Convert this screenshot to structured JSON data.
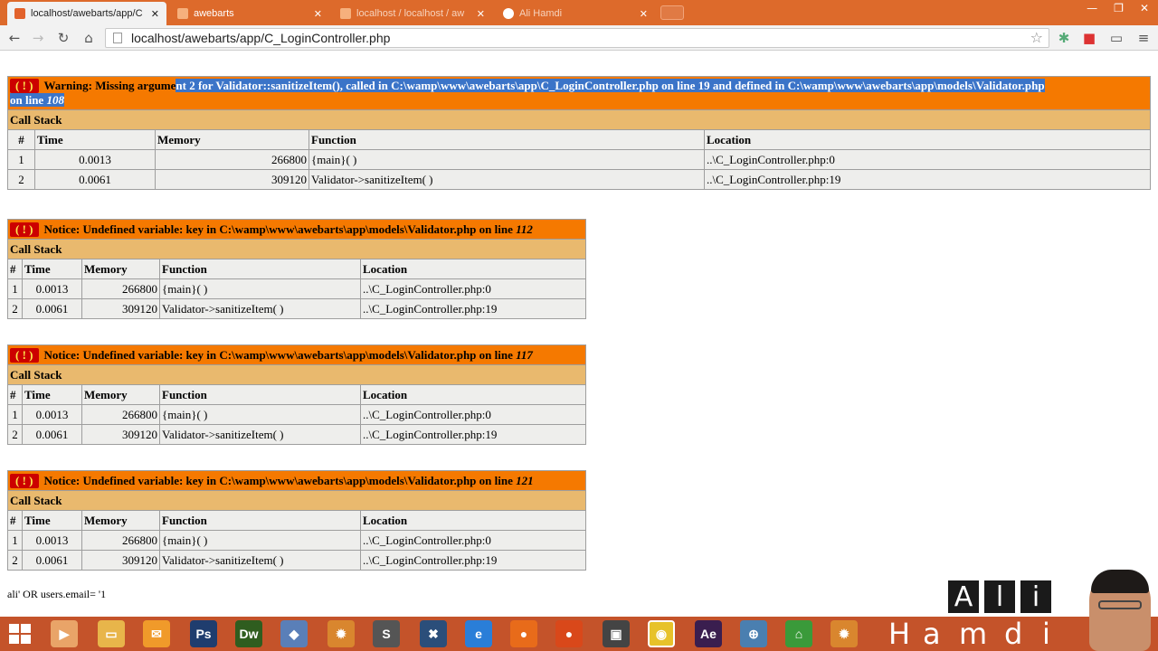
{
  "browser": {
    "tabs": [
      {
        "label": "localhost/awebarts/app/C",
        "active": true
      },
      {
        "label": "awebarts",
        "active": false
      },
      {
        "label": "localhost / localhost / aw",
        "active": false
      },
      {
        "label": "Ali Hamdi",
        "active": false
      }
    ],
    "url": "localhost/awebarts/app/C_LoginController.php"
  },
  "errors": [
    {
      "prefix": "( ! )",
      "message_pre": "Warning: Missing argume",
      "message_sel": "nt 2 for Validator::sanitizeItem(), called in C:\\wamp\\www\\awebarts\\app\\C_LoginController.php on line 19 and defined in C:\\wamp\\www\\awebarts\\app\\models\\Validator.php",
      "message_sel2": "on line ",
      "line": "108",
      "call_stack_label": "Call Stack",
      "columns": [
        "#",
        "Time",
        "Memory",
        "Function",
        "Location"
      ],
      "rows": [
        [
          "1",
          "0.0013",
          "266800",
          "{main}( )",
          "..\\C_LoginController.php:0"
        ],
        [
          "2",
          "0.0061",
          "309120",
          "Validator->sanitizeItem( )",
          "..\\C_LoginController.php:19"
        ]
      ]
    },
    {
      "prefix": "( ! )",
      "message": "Notice: Undefined variable: key in C:\\wamp\\www\\awebarts\\app\\models\\Validator.php on line ",
      "line": "112",
      "call_stack_label": "Call Stack",
      "columns": [
        "#",
        "Time",
        "Memory",
        "Function",
        "Location"
      ],
      "rows": [
        [
          "1",
          "0.0013",
          "266800",
          "{main}( )",
          "..\\C_LoginController.php:0"
        ],
        [
          "2",
          "0.0061",
          "309120",
          "Validator->sanitizeItem( )",
          "..\\C_LoginController.php:19"
        ]
      ]
    },
    {
      "prefix": "( ! )",
      "message": "Notice: Undefined variable: key in C:\\wamp\\www\\awebarts\\app\\models\\Validator.php on line ",
      "line": "117",
      "call_stack_label": "Call Stack",
      "columns": [
        "#",
        "Time",
        "Memory",
        "Function",
        "Location"
      ],
      "rows": [
        [
          "1",
          "0.0013",
          "266800",
          "{main}( )",
          "..\\C_LoginController.php:0"
        ],
        [
          "2",
          "0.0061",
          "309120",
          "Validator->sanitizeItem( )",
          "..\\C_LoginController.php:19"
        ]
      ]
    },
    {
      "prefix": "( ! )",
      "message": "Notice: Undefined variable: key in C:\\wamp\\www\\awebarts\\app\\models\\Validator.php on line ",
      "line": "121",
      "call_stack_label": "Call Stack",
      "columns": [
        "#",
        "Time",
        "Memory",
        "Function",
        "Location"
      ],
      "rows": [
        [
          "1",
          "0.0013",
          "266800",
          "{main}( )",
          "..\\C_LoginController.php:0"
        ],
        [
          "2",
          "0.0061",
          "309120",
          "Validator->sanitizeItem( )",
          "..\\C_LoginController.php:19"
        ]
      ]
    }
  ],
  "sql_output": "ali' OR users.email= '1",
  "taskbar": {
    "apps": [
      "Ps",
      "Dw",
      "Ae"
    ]
  },
  "overlay": {
    "top_letters": [
      "A",
      "l",
      "i"
    ],
    "bottom_letters": [
      "H",
      "a",
      "m",
      "d",
      "i"
    ]
  },
  "colors": {
    "chrome_orange": "#dd6a2b",
    "error_header": "#f57900",
    "call_stack": "#e9b96e",
    "cell_bg": "#eeeeec",
    "selection": "#3b74c8"
  },
  "icons": [
    "back-icon",
    "forward-icon",
    "reload-icon",
    "home-icon",
    "star-icon",
    "page-icon"
  ]
}
